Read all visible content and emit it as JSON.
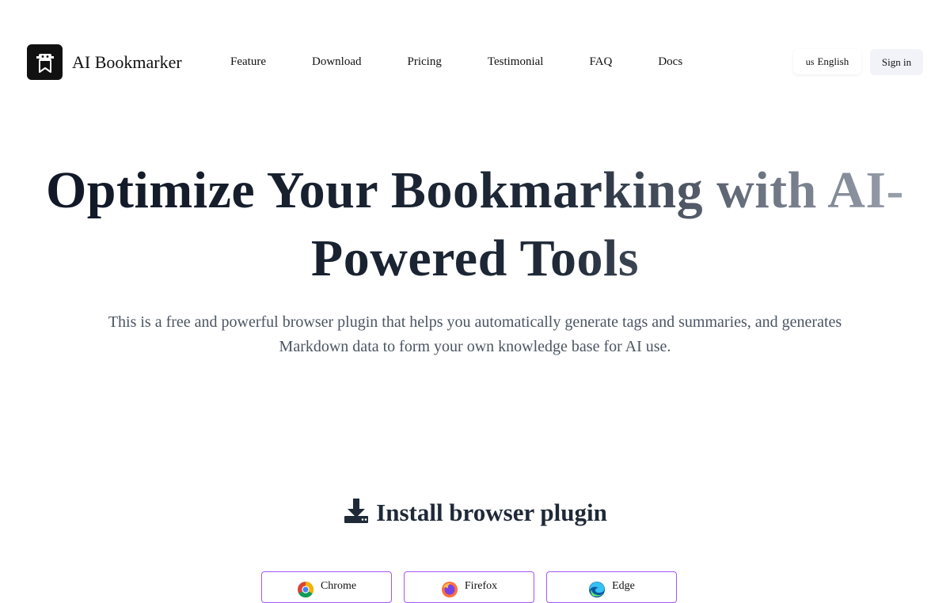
{
  "brand": {
    "name": "AI Bookmarker",
    "logo_icon": "bookmark-robot-icon"
  },
  "nav": {
    "items": [
      {
        "label": "Feature"
      },
      {
        "label": "Download"
      },
      {
        "label": "Pricing"
      },
      {
        "label": "Testimonial"
      },
      {
        "label": "FAQ"
      },
      {
        "label": "Docs"
      }
    ]
  },
  "header": {
    "language_flag": "us",
    "language_label": "English",
    "signin_label": "Sign in"
  },
  "hero": {
    "title": "Optimize Your Bookmarking with AI-Powered Tools",
    "subtitle": "This is a free and powerful browser plugin that helps you automatically generate tags and summaries, and generates Markdown data to form your own knowledge base for AI use."
  },
  "install": {
    "icon": "download-icon",
    "title": "Install browser plugin",
    "browsers": [
      {
        "label": "Chrome",
        "icon": "chrome-icon"
      },
      {
        "label": "Firefox",
        "icon": "firefox-icon"
      },
      {
        "label": "Edge",
        "icon": "edge-icon"
      }
    ]
  },
  "colors": {
    "accent_border": "#a855f7",
    "signin_bg": "#f1f3f9",
    "title_dark": "#1f2937"
  }
}
